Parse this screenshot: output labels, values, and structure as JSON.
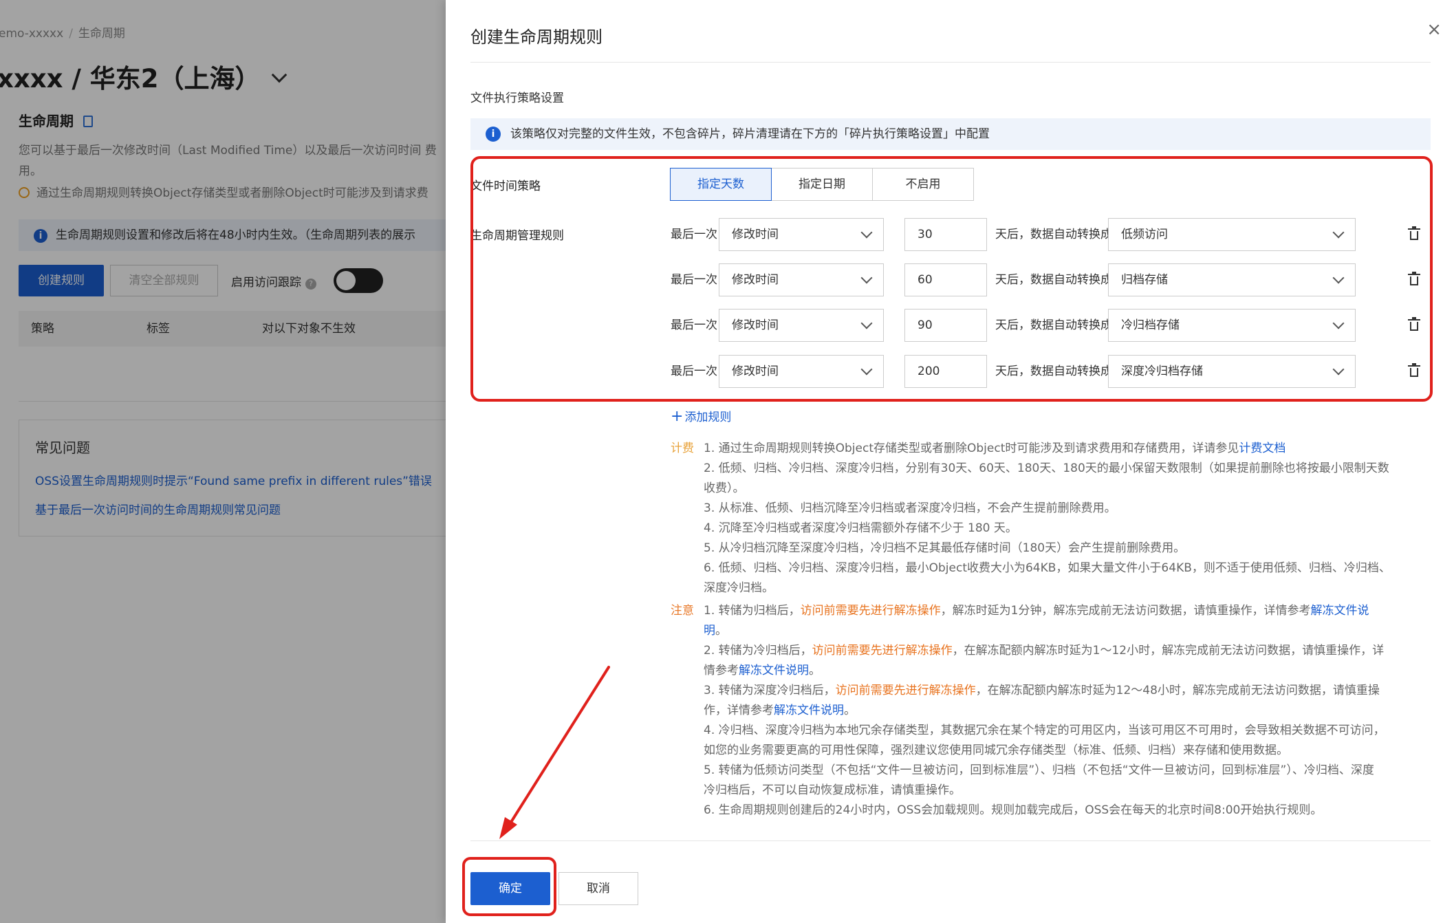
{
  "background": {
    "breadcrumb": [
      "emo-xxxxx",
      "生命周期"
    ],
    "bucket_title": "xxxx / 华东2（上海）",
    "section_title": "生命周期",
    "description": "您可以基于最后一次修改时间（Last Modified Time）以及最后一次访问时间 费用。",
    "warning": "通过生命周期规则转换Object存储类型或者删除Object时可能涉及到请求费",
    "notice": "生命周期规则设置和修改后将在48小时内生效。（生命周期列表的展示",
    "create_button": "创建规则",
    "clear_button": "清空全部规则",
    "access_tracking_label": "启用访问跟踪",
    "table_headers": [
      "策略",
      "标签",
      "对以下对象不生效"
    ],
    "faq_title": "常见问题",
    "faq_links": [
      "OSS设置生命周期规则时提示“Found same prefix in different rules”错误",
      "基于最后一次访问时间的生命周期规则常见问题"
    ]
  },
  "drawer": {
    "title": "创建生命周期规则",
    "section": "文件执行策略设置",
    "info": "该策略仅对完整的文件生效，不包含碎片，碎片清理请在下方的「碎片执行策略设置」中配置",
    "time_policy_label": "文件时间策略",
    "time_policy_options": [
      "指定天数",
      "指定日期",
      "不启用"
    ],
    "time_policy_selected": "指定天数",
    "rules_label": "生命周期管理规则",
    "rule_prefix": "最后一次",
    "rule_mid": "天后，数据自动转换成",
    "rules": [
      {
        "basis": "修改时间",
        "days": "30",
        "target": "低频访问"
      },
      {
        "basis": "修改时间",
        "days": "60",
        "target": "归档存储"
      },
      {
        "basis": "修改时间",
        "days": "90",
        "target": "冷归档存储"
      },
      {
        "basis": "修改时间",
        "days": "200",
        "target": "深度冷归档存储"
      }
    ],
    "add_rule": "添加规则",
    "billing_tag": "计费",
    "billing": {
      "l1a": "1. 通过生命周期规则转换Object存储类型或者删除Object时可能涉及到请求费用和存储费用，详请参见",
      "l1link": "计费文档",
      "l2a": "2. 低频、归档、冷归档、深度冷归档，分别有30天、60天、180天、180天的最小保留天数限制（如果提前删除也将按最小限制天数",
      "l2b": "收费）。",
      "l3": "3. 从标准、低频、归档沉降至冷归档或者深度冷归档，不会产生提前删除费用。",
      "l4": "4. 沉降至冷归档或者深度冷归档需额外存储不少于 180 天。",
      "l5": "5. 从冷归档沉降至深度冷归档，冷归档不足其最低存储时间（180天）会产生提前删除费用。",
      "l6a": "6. 低频、归档、冷归档、深度冷归档，最小Object收费大小为64KB，如果大量文件小于64KB，则不适于使用低频、归档、冷归档、",
      "l6b": "深度冷归档。"
    },
    "notice_tag": "注意",
    "notice": {
      "n1a": "1. 转储为归档后，",
      "n1o": "访问前需要先进行解冻操作",
      "n1b": "，解冻时延为1分钟，解冻完成前无法访问数据，请慎重操作，详情参考",
      "n1l": "解冻文件说",
      "n1l2": "明",
      "n1c": "。",
      "n2a": "2. 转储为冷归档后，",
      "n2o": "访问前需要先进行解冻操作",
      "n2b": "，在解冻配额内解冻时延为1～12小时，解冻完成前无法访问数据，请慎重操作，详",
      "n2c": "情参考",
      "n2l": "解冻文件说明",
      "n2d": "。",
      "n3a": "3. 转储为深度冷归档后，",
      "n3o": "访问前需要先进行解冻操作",
      "n3b": "，在解冻配额内解冻时延为12～48小时，解冻完成前无法访问数据，请慎重操",
      "n3c": "作，详情参考",
      "n3l": "解冻文件说明",
      "n3d": "。",
      "n4a": "4. 冷归档、深度冷归档为本地冗余存储类型，其数据冗余在某个特定的可用区内，当该可用区不可用时，会导致相关数据不可访问，",
      "n4b": "如您的业务需要更高的可用性保障，强烈建议您使用同城冗余存储类型（标准、低频、归档）来存储和使用数据。",
      "n5a": "5. 转储为低频访问类型（不包括“文件一旦被访问，回到标准层”）、归档（不包括“文件一旦被访问，回到标准层”）、冷归档、深度",
      "n5b": "冷归档后，不可以自动恢复成标准，请慎重操作。",
      "n6": "6. 生命周期规则创建后的24小时内，OSS会加载规则。规则加载完成后，OSS会在每天的北京时间8:00开始执行规则。"
    },
    "confirm_button": "确定",
    "cancel_button": "取消"
  },
  "colors": {
    "primary": "#1c5fd0",
    "annotation": "#e0211c"
  }
}
